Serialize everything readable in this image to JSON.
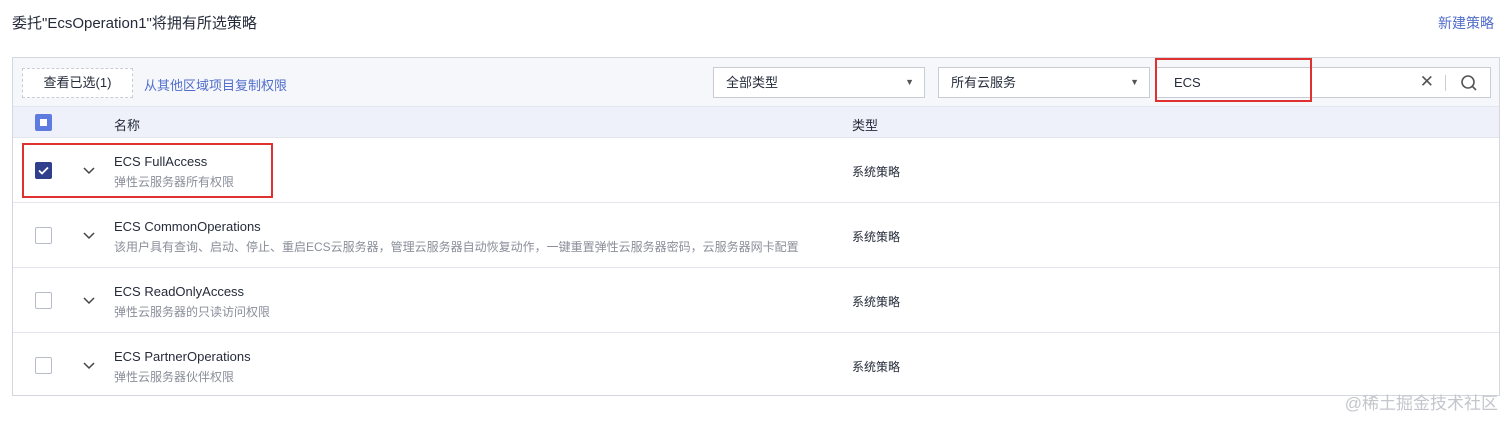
{
  "header": {
    "title": "委托\"EcsOperation1\"将拥有所选策略",
    "new_policy": "新建策略"
  },
  "toolbar": {
    "view_selected": "查看已选(1)",
    "copy_link": "从其他区域项目复制权限",
    "type_filter": "全部类型",
    "service_filter": "所有云服务",
    "search_value": "ECS"
  },
  "table": {
    "headers": {
      "name": "名称",
      "type": "类型"
    },
    "rows": [
      {
        "name": "ECS FullAccess",
        "desc": "弹性云服务器所有权限",
        "type": "系统策略",
        "checked": true
      },
      {
        "name": "ECS CommonOperations",
        "desc": "该用户具有查询、启动、停止、重启ECS云服务器，管理云服务器自动恢复动作，一键重置弹性云服务器密码，云服务器网卡配置",
        "type": "系统策略",
        "checked": false
      },
      {
        "name": "ECS ReadOnlyAccess",
        "desc": "弹性云服务器的只读访问权限",
        "type": "系统策略",
        "checked": false
      },
      {
        "name": "ECS PartnerOperations",
        "desc": "弹性云服务器伙伴权限",
        "type": "系统策略",
        "checked": false
      }
    ]
  },
  "watermark": "@稀土掘金技术社区"
}
